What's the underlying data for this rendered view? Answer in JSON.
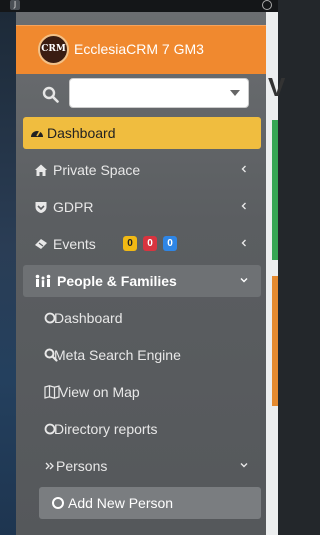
{
  "topbar": {
    "left_glyph": "J"
  },
  "brand": {
    "logo_text": "CRM",
    "name": "EcclesiaCRM 7 GM3"
  },
  "search": {
    "placeholder": "",
    "value": ""
  },
  "menu": {
    "dashboard": "Dashboard",
    "private_space": "Private Space",
    "gdpr": "GDPR",
    "events": "Events",
    "events_badges": [
      "0",
      "0",
      "0"
    ],
    "people_families": "People & Families",
    "sub": {
      "dashboard": "Dashboard",
      "meta_search": "Meta Search Engine",
      "view_on_map": "View on Map",
      "directory_reports": "Directory reports",
      "persons": "Persons",
      "add_new_person": "Add New Person"
    }
  },
  "main": {
    "heading_fragment": "V"
  },
  "colors": {
    "brand": "#f0892f",
    "active": "#f0bd3f",
    "badge_yellow": "#f1b914",
    "badge_red": "#d9343f",
    "badge_blue": "#2f86e6"
  }
}
